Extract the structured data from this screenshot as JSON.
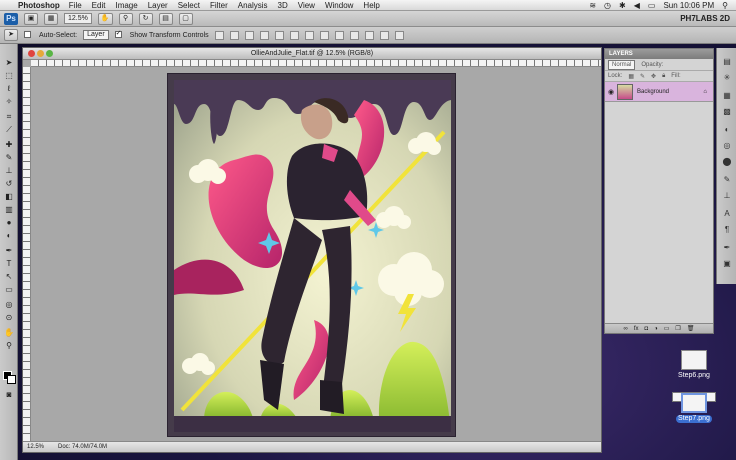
{
  "menubar": {
    "app": "Photoshop",
    "items": [
      "File",
      "Edit",
      "Image",
      "Layer",
      "Select",
      "Filter",
      "Analysis",
      "3D",
      "View",
      "Window",
      "Help"
    ],
    "clock": "Sun 10:06 PM"
  },
  "appbar": {
    "logo": "Ps",
    "zoom": "12.5%",
    "workspace": "PH7LABS 2D"
  },
  "options": {
    "auto_select_label": "Auto-Select:",
    "auto_select_value": "Layer",
    "transform_label": "Show Transform Controls"
  },
  "document": {
    "title": "OllieAndJulie_Flat.tif @ 12.5% (RGB/8)",
    "status_zoom": "12.5%",
    "status_doc": "Doc: 74.0M/74.0M"
  },
  "layers_panel": {
    "title": "LAYERS",
    "blend_mode": "Normal",
    "opacity_label": "Opacity:",
    "lock_label": "Lock:",
    "fill_label": "Fill:",
    "layers": [
      {
        "name": "Background"
      }
    ]
  },
  "desktop": {
    "files": [
      {
        "name": "Step6.png",
        "selected": false
      },
      {
        "name": "Step7.png",
        "selected": true
      }
    ]
  },
  "colors": {
    "accent_layer": "#d9b4dd",
    "canvas_frame": "#453b4a"
  }
}
